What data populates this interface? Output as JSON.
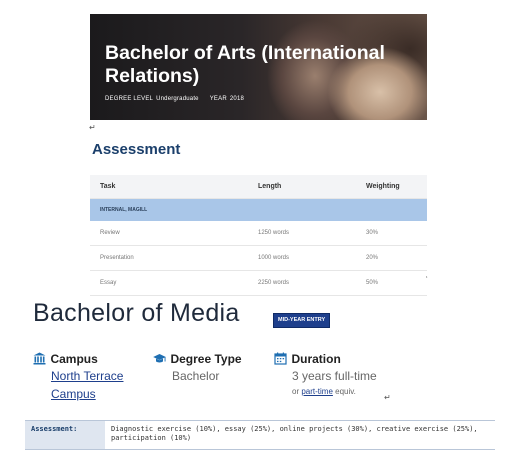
{
  "hero": {
    "title": "Bachelor of Arts (International Relations)",
    "meta": {
      "degree_level_label": "DEGREE LEVEL",
      "degree_level_value": "Undergraduate",
      "year_label": "YEAR",
      "year_value": "2018"
    }
  },
  "paragraph_mark": "↵",
  "assessment": {
    "heading": "Assessment",
    "columns": [
      "Task",
      "Length",
      "Weighting"
    ],
    "section": "INTERNAL, MAGILL",
    "rows": [
      {
        "task": "Review",
        "length": "1250 words",
        "weighting": "30%"
      },
      {
        "task": "Presentation",
        "length": "1000 words",
        "weighting": "20%"
      },
      {
        "task": "Essay",
        "length": "2250 words",
        "weighting": "50%"
      }
    ]
  },
  "stray_tick": "‘",
  "media": {
    "title": "Bachelor of Media",
    "badge": "MID-YEAR ENTRY",
    "campus": {
      "label": "Campus",
      "icon": "building-icon",
      "value_line1": "North Terrace",
      "value_line2": "Campus"
    },
    "degree_type": {
      "label": "Degree Type",
      "icon": "graduation-cap-icon",
      "value": "Bachelor"
    },
    "duration": {
      "label": "Duration",
      "icon": "calendar-icon",
      "value": "3 years full-time",
      "note_prefix": "or ",
      "note_link": "part-time",
      "note_suffix": " equiv."
    },
    "paragraph_mark": "↵"
  },
  "assessment_bar": {
    "label": "Assessment:",
    "text": "Diagnostic exercise (10%), essay (25%), online projects (30%), creative exercise (25%), participation (10%)"
  },
  "colors": {
    "heading_blue": "#1b3f6b",
    "section_blue": "#a9c6e8",
    "badge_blue": "#1e3f8c",
    "link_blue": "#1e3f8c",
    "icon_blue": "#1f6fb2"
  }
}
